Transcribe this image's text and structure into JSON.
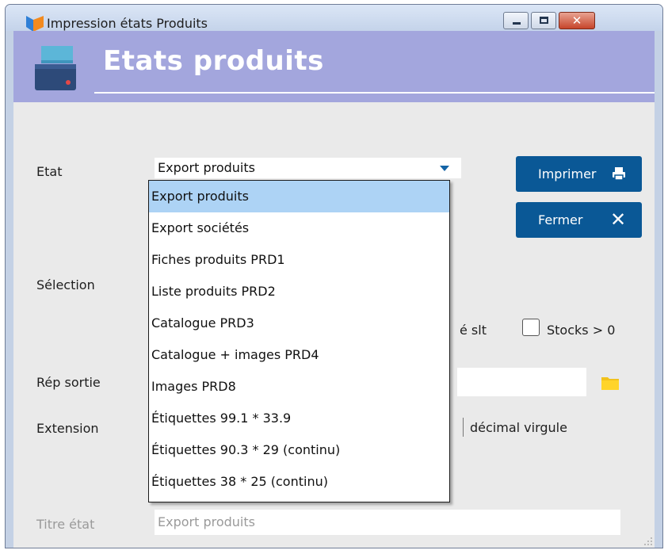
{
  "window": {
    "title": "Impression états Produits"
  },
  "header": {
    "title": "Etats produits"
  },
  "form": {
    "etat_label": "Etat",
    "etat_value": "Export produits",
    "selection_label": "Sélection",
    "stock_partial_label": "é slt",
    "stocks_label": "Stocks > 0",
    "stocks_checked": false,
    "rep_sortie_label": "Rép sortie",
    "extension_label": "Extension",
    "decimal_label": "décimal virgule",
    "titre_label": "Titre état",
    "titre_value": "Export produits"
  },
  "buttons": {
    "print_label": "Imprimer",
    "close_label": "Fermer"
  },
  "dropdown": {
    "selected_index": 0,
    "items": [
      "Export produits",
      "Export sociétés",
      "Fiches produits PRD1",
      "Liste produits PRD2",
      "Catalogue PRD3",
      "Catalogue + images PRD4",
      "Images PRD8",
      "Étiquettes 99.1 * 33.9",
      "Étiquettes 90.3 * 29 (continu)",
      "Étiquettes 38 * 25 (continu)"
    ]
  },
  "colors": {
    "header_bg": "#a3a6dd",
    "button_bg": "#0a5896",
    "selected_item": "#add3f5",
    "client_bg": "#eaeaea"
  },
  "icons": {
    "app": "app-logo-icon",
    "header": "printer-icon",
    "print": "printer-icon",
    "close": "close-icon",
    "folder": "folder-icon",
    "dropdown": "chevron-down-icon"
  }
}
